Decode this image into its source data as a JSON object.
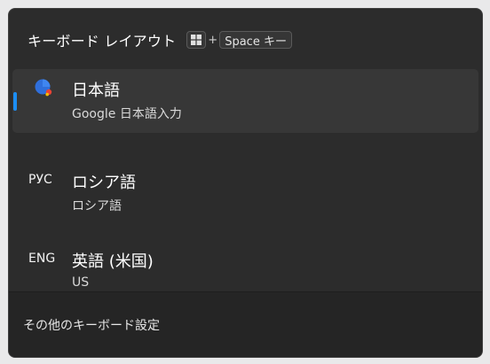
{
  "header": {
    "title": "キーボード レイアウト",
    "shortcut": {
      "win_key_icon": "windows-logo-icon",
      "plus": "+",
      "space_key": "Space キー"
    }
  },
  "layouts": [
    {
      "icon": "google-japanese-input-icon",
      "abbr": "",
      "title": "日本語",
      "subtitle": "Google 日本語入力",
      "selected": true
    },
    {
      "icon": "",
      "abbr": "РУС",
      "title": "ロシア語",
      "subtitle": "ロシア語",
      "selected": false
    },
    {
      "icon": "",
      "abbr": "ENG",
      "title": "英語 (米国)",
      "subtitle": "US",
      "selected": false
    }
  ],
  "footer": {
    "settings_link": "その他のキーボード設定"
  },
  "colors": {
    "panel_bg": "#2c2c2c",
    "selected_bg": "#373737",
    "accent": "#1c8ef5",
    "footer_bg": "#252525"
  }
}
